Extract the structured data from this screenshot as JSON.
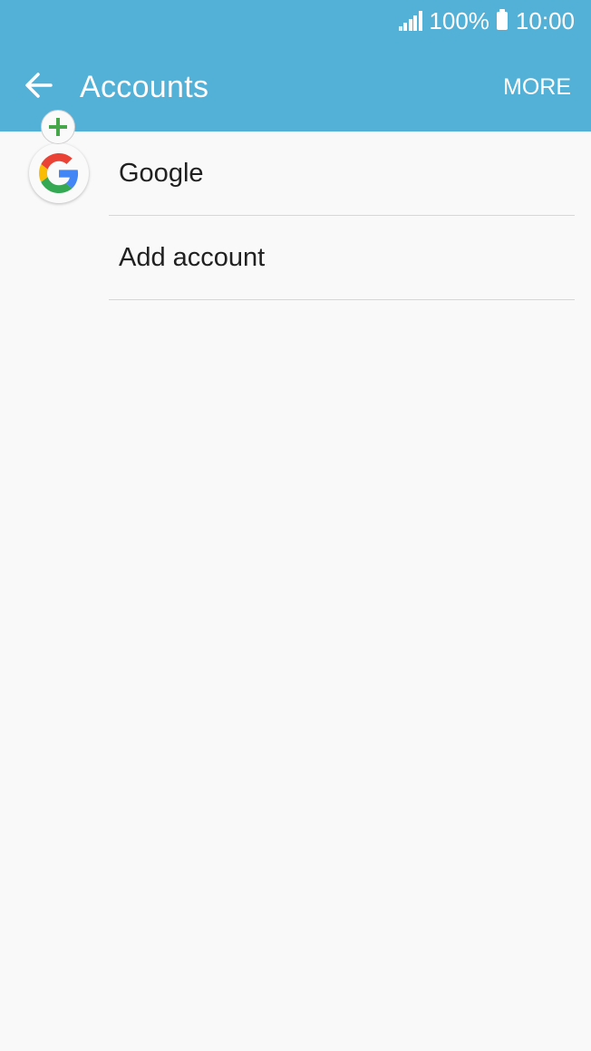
{
  "status_bar": {
    "battery_percent": "100%",
    "time": "10:00"
  },
  "header": {
    "title": "Accounts",
    "more_label": "MORE"
  },
  "accounts": [
    {
      "label": "Google",
      "icon": "google-logo-icon"
    },
    {
      "label": "Add account",
      "icon": "plus-icon"
    }
  ],
  "colors": {
    "header_bg": "#53b0d6",
    "page_bg": "#f9f9f9",
    "add_icon": "#45a64a"
  }
}
